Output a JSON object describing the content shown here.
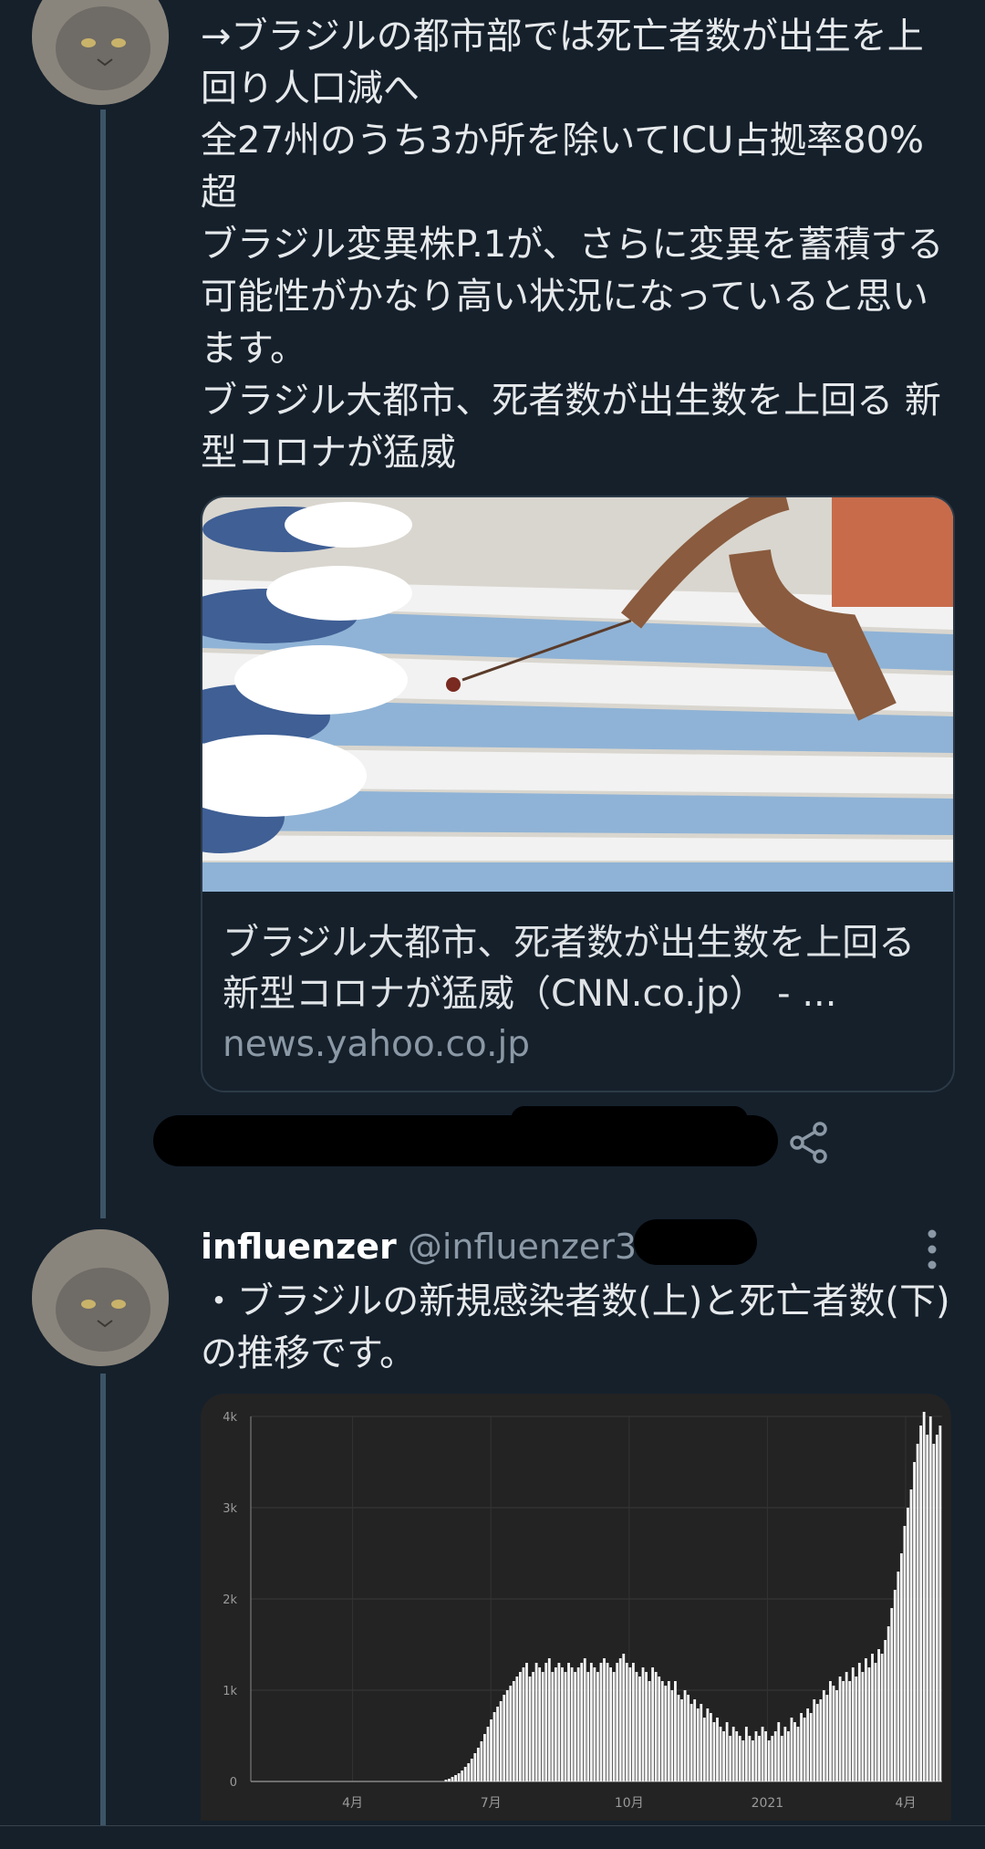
{
  "tweet1": {
    "text": "→ブラジルの都市部では死亡者数が出生を上回り人口減へ\n全27州のうち3か所を除いてICU占拠率80%超\nブラジル変異株P.1が、さらに変異を蓄積する可能性がかなり高い状況になっていると思います。\nブラジル大都市、死者数が出生数を上回る 新型コロナが猛威",
    "card": {
      "title": "ブラジル大都市、死者数が出生数を上回る　新型コロナが猛威（CNN.co.jp） - ...",
      "domain": "news.yahoo.co.jp"
    }
  },
  "tweet2": {
    "name": "influenzer",
    "handle": "@influenzer3 ·",
    "text": "・ブラジルの新規感染者数(上)と死亡者数(下)の推移です。"
  },
  "icons": [
    "avatar-cat",
    "share-icon",
    "more-vert-icon"
  ],
  "colors": {
    "background": "#15202b",
    "thread_line": "#3d5466",
    "muted": "#8b98a5",
    "chart_bg": "#232323"
  },
  "chart_data": {
    "type": "bar",
    "ylim": [
      0,
      4000
    ],
    "yticks": [
      "0",
      "1k",
      "2k",
      "3k",
      "4k"
    ],
    "xticks": [
      "4月",
      "7月",
      "10月",
      "2021",
      "4月"
    ],
    "values": [
      0,
      0,
      0,
      0,
      0,
      0,
      0,
      0,
      0,
      0,
      0,
      0,
      0,
      0,
      0,
      0,
      0,
      0,
      0,
      0,
      0,
      0,
      0,
      0,
      0,
      0,
      0,
      0,
      0,
      0,
      0,
      0,
      0,
      0,
      0,
      0,
      0,
      0,
      0,
      0,
      0,
      0,
      0,
      0,
      0,
      0,
      0,
      0,
      0,
      0,
      0,
      0,
      0,
      0,
      0,
      0,
      0,
      0,
      0,
      0,
      20,
      30,
      50,
      70,
      90,
      120,
      160,
      200,
      250,
      310,
      370,
      440,
      520,
      600,
      680,
      760,
      820,
      880,
      950,
      1000,
      1050,
      1100,
      1150,
      1200,
      1250,
      1300,
      1150,
      1200,
      1300,
      1250,
      1200,
      1300,
      1350,
      1200,
      1250,
      1300,
      1250,
      1200,
      1300,
      1250,
      1200,
      1250,
      1300,
      1350,
      1200,
      1300,
      1250,
      1200,
      1300,
      1350,
      1300,
      1250,
      1200,
      1300,
      1350,
      1400,
      1300,
      1250,
      1300,
      1200,
      1150,
      1250,
      1200,
      1100,
      1250,
      1200,
      1150,
      1100,
      1050,
      1100,
      1000,
      1100,
      950,
      900,
      1000,
      950,
      850,
      900,
      800,
      850,
      700,
      800,
      750,
      650,
      700,
      600,
      550,
      650,
      500,
      600,
      550,
      500,
      450,
      600,
      500,
      450,
      550,
      500,
      600,
      550,
      450,
      500,
      550,
      650,
      500,
      600,
      550,
      700,
      650,
      600,
      750,
      700,
      800,
      750,
      900,
      850,
      900,
      1000,
      950,
      1100,
      1050,
      1000,
      1150,
      1100,
      1200,
      1100,
      1250,
      1150,
      1300,
      1200,
      1350,
      1250,
      1400,
      1300,
      1450,
      1400,
      1550,
      1700,
      1900,
      2100,
      2300,
      2500,
      2800,
      3000,
      3200,
      3500,
      3700,
      3900,
      4050,
      3800,
      4000,
      3700,
      3800,
      3900
    ]
  }
}
